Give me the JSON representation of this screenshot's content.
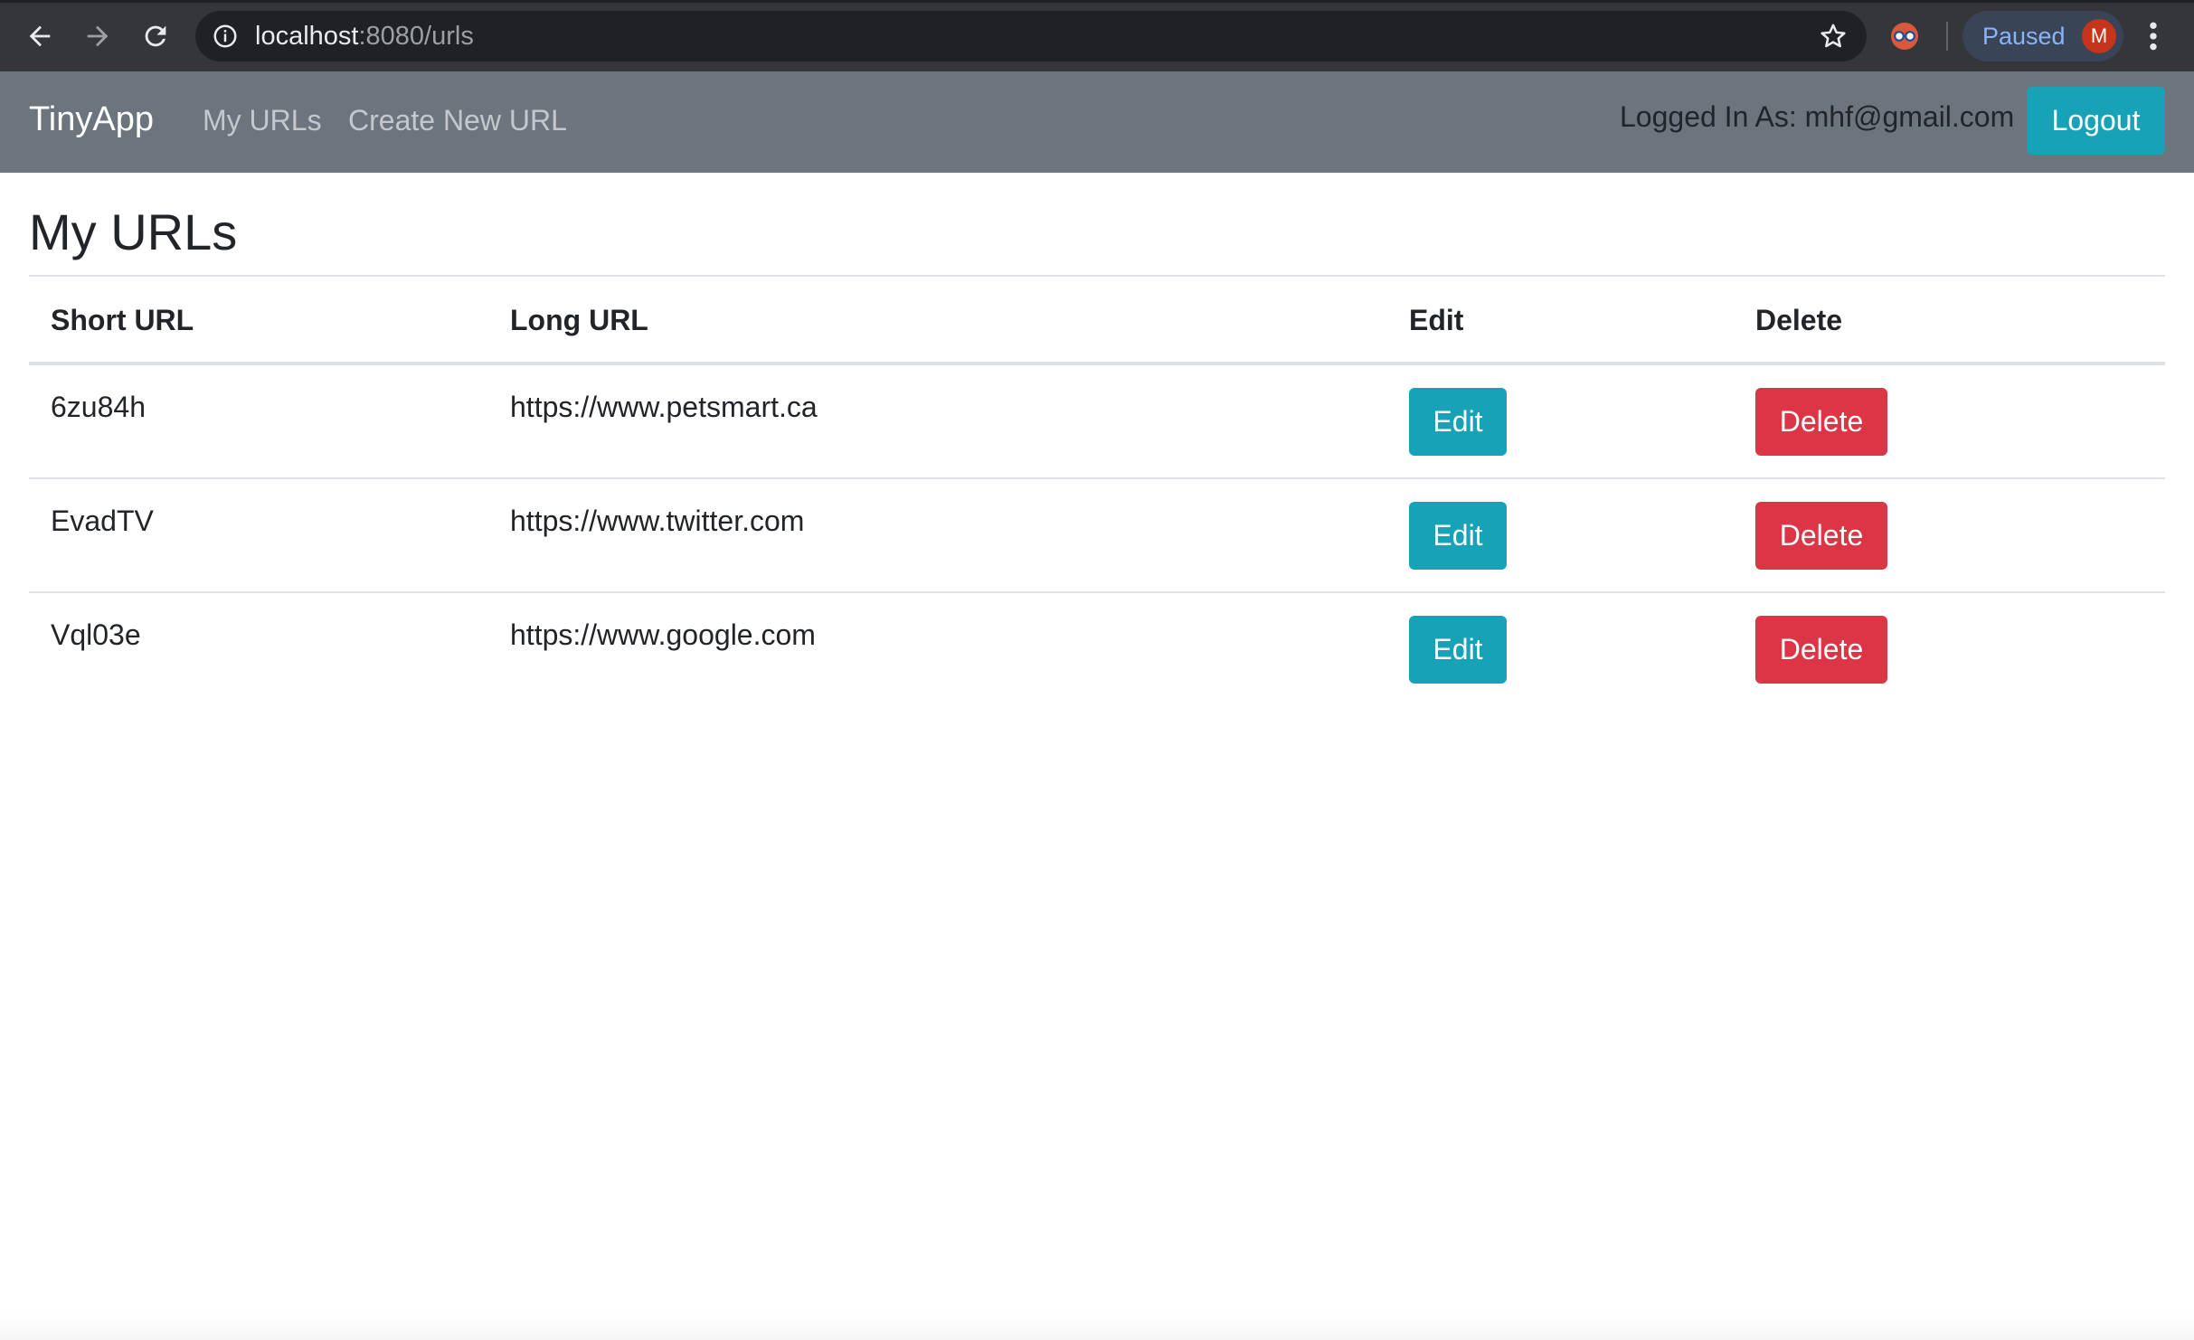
{
  "browser": {
    "url_host": "localhost",
    "url_rest": ":8080/urls",
    "profile_status": "Paused",
    "profile_initial": "M"
  },
  "navbar": {
    "brand": "TinyApp",
    "links": [
      "My URLs",
      "Create New URL"
    ],
    "logged_in_text": "Logged In As: mhf@gmail.com",
    "logout_label": "Logout"
  },
  "page": {
    "title": "My URLs"
  },
  "table": {
    "headers": [
      "Short URL",
      "Long URL",
      "Edit",
      "Delete"
    ],
    "rows": [
      {
        "short": "6zu84h",
        "long": "https://www.petsmart.ca",
        "edit": "Edit",
        "delete": "Delete"
      },
      {
        "short": "EvadTV",
        "long": "https://www.twitter.com",
        "edit": "Edit",
        "delete": "Delete"
      },
      {
        "short": "Vql03e",
        "long": "https://www.google.com",
        "edit": "Edit",
        "delete": "Delete"
      }
    ]
  },
  "colors": {
    "navbar_bg": "#6c757d",
    "info_button": "#17a2b8",
    "danger_button": "#dc3545"
  }
}
